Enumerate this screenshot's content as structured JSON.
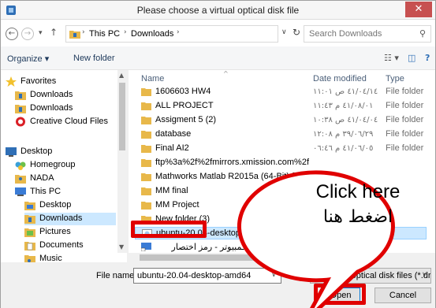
{
  "window": {
    "title": "Please choose a virtual optical disk file",
    "close_glyph": "✕",
    "app_icon": "virtualbox-icon"
  },
  "addressbar": {
    "back_glyph": "←",
    "forward_glyph": "→",
    "recent_glyph": "▾",
    "up_glyph": "↑",
    "crumb_sep": "›",
    "crumbs": [
      "This PC",
      "Downloads"
    ],
    "dropdown_glyph": "∨",
    "refresh_glyph": "↻",
    "search_placeholder": "Search Downloads",
    "search_glyph": "⚲"
  },
  "toolbar": {
    "organize_label": "Organize ▾",
    "new_folder_label": "New folder",
    "view_glyph": "☷ ▾",
    "preview_glyph": "◫",
    "help_glyph": "?"
  },
  "navpane": {
    "items": [
      {
        "label": "Favorites",
        "icon": "star-icon"
      },
      {
        "label": "Downloads",
        "icon": "downloads-folder-icon"
      },
      {
        "label": "Downloads",
        "icon": "downloads-folder-icon"
      },
      {
        "label": "Creative Cloud Files",
        "icon": "creative-cloud-icon"
      },
      {
        "label": "Desktop",
        "icon": "desktop-icon"
      },
      {
        "label": "Homegroup",
        "icon": "homegroup-icon"
      },
      {
        "label": "NADA",
        "icon": "user-folder-icon"
      },
      {
        "label": "This PC",
        "icon": "computer-icon"
      },
      {
        "label": "Desktop",
        "icon": "folder-icon"
      },
      {
        "label": "Downloads",
        "icon": "downloads-folder-icon"
      },
      {
        "label": "Pictures",
        "icon": "pictures-folder-icon"
      },
      {
        "label": "Documents",
        "icon": "documents-folder-icon"
      },
      {
        "label": "Music",
        "icon": "music-folder-icon"
      }
    ],
    "scroll_up_glyph": "▲",
    "scroll_down_glyph": "▼"
  },
  "filelist": {
    "sort_glyph": "^",
    "columns": {
      "name": "Name",
      "date": "Date modified",
      "type": "Type"
    },
    "rows": [
      {
        "name": "1606603 HW4",
        "date": "٤١/٠٤/١٤ ص ١١:٠١",
        "type": "File folder",
        "icon": "folder-icon"
      },
      {
        "name": "ALL PROJECT",
        "date": "٤١/٠٨/٠١ م ١١:٤٣",
        "type": "File folder",
        "icon": "folder-icon"
      },
      {
        "name": "Assigment 5 (2)",
        "date": "٤١/٠٤/٠٤ ص ١٠:٣٨",
        "type": "File folder",
        "icon": "folder-icon"
      },
      {
        "name": "database",
        "date": "٣٩/٠٦/٢٩ م ١٢:٠٨",
        "type": "File folder",
        "icon": "folder-icon"
      },
      {
        "name": "Final AI2",
        "date": "٤١/٠٦/٠٥ م ٠٦:٤٦",
        "type": "File folder",
        "icon": "folder-icon"
      },
      {
        "name": "ftp%3a%2f%2fmirrors.xmission.com%2fc...",
        "date": "",
        "type": "",
        "icon": "folder-icon"
      },
      {
        "name": "Mathworks Matlab R2015a (64-Bit)-[Fi...",
        "date": "",
        "type": "",
        "icon": "folder-icon"
      },
      {
        "name": "MM final",
        "date": "",
        "type": "",
        "icon": "folder-icon"
      },
      {
        "name": "MM Project",
        "date": "",
        "type": "",
        "icon": "folder-icon"
      },
      {
        "name": "New folder (3)",
        "date": "",
        "type": "",
        "icon": "folder-icon"
      },
      {
        "name": "ubuntu-20.04-desktop-amd64",
        "date": "",
        "type": "",
        "icon": "disc-image-icon"
      },
      {
        "name": "هذا الكمبيوتر - رمز اختصار",
        "date": "",
        "type": "",
        "icon": "shortcut-icon"
      }
    ]
  },
  "bottom": {
    "filename_label": "File name:",
    "filename_value": "ubuntu-20.04-desktop-amd64",
    "dropdown_glyph": "∨",
    "filter_value": "All virtual optical disk files (*.dr",
    "open_label": "Open",
    "cancel_label": "Cancel"
  },
  "callout": {
    "english": "Click here",
    "arabic": "اضغط هنا"
  },
  "colors": {
    "accent": "#0078d7",
    "highlight": "#e00000",
    "selection": "#cce8ff",
    "close": "#c75050"
  }
}
